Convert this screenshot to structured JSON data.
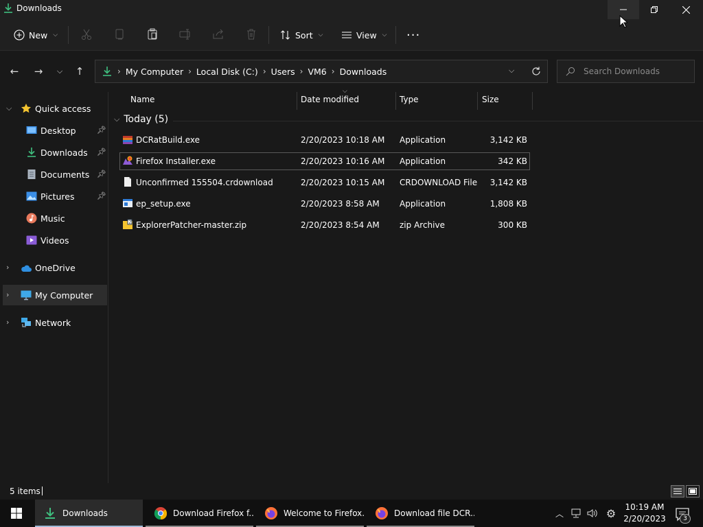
{
  "window": {
    "title": "Downloads"
  },
  "commandbar": {
    "new_label": "New",
    "sort_label": "Sort",
    "view_label": "View",
    "more_label": "···"
  },
  "address": {
    "crumbs": [
      "My Computer",
      "Local Disk (C:)",
      "Users",
      "VM6",
      "Downloads"
    ],
    "search_placeholder": "Search Downloads"
  },
  "sidebar": {
    "items": [
      {
        "label": "Quick access",
        "icon": "star-icon"
      },
      {
        "label": "Desktop",
        "icon": "desktop-icon"
      },
      {
        "label": "Downloads",
        "icon": "download-icon"
      },
      {
        "label": "Documents",
        "icon": "document-icon"
      },
      {
        "label": "Pictures",
        "icon": "pictures-icon"
      },
      {
        "label": "Music",
        "icon": "music-icon"
      },
      {
        "label": "Videos",
        "icon": "videos-icon"
      },
      {
        "label": "OneDrive",
        "icon": "cloud-icon"
      },
      {
        "label": "My Computer",
        "icon": "computer-icon"
      },
      {
        "label": "Network",
        "icon": "network-icon"
      }
    ]
  },
  "filelist": {
    "columns": {
      "name": "Name",
      "date": "Date modified",
      "type": "Type",
      "size": "Size"
    },
    "group": "Today (5)",
    "rows": [
      {
        "name": "DCRatBuild.exe",
        "date": "2/20/2023 10:18 AM",
        "type": "Application",
        "size": "3,142 KB",
        "icon": "installer-icon"
      },
      {
        "name": "Firefox Installer.exe",
        "date": "2/20/2023 10:16 AM",
        "type": "Application",
        "size": "342 KB",
        "icon": "firefox-installer-icon"
      },
      {
        "name": "Unconfirmed 155504.crdownload",
        "date": "2/20/2023 10:15 AM",
        "type": "CRDOWNLOAD File",
        "size": "3,142 KB",
        "icon": "blank-file-icon"
      },
      {
        "name": "ep_setup.exe",
        "date": "2/20/2023 8:58 AM",
        "type": "Application",
        "size": "1,808 KB",
        "icon": "app-window-icon"
      },
      {
        "name": "ExplorerPatcher-master.zip",
        "date": "2/20/2023 8:54 AM",
        "type": "zip Archive",
        "size": "300 KB",
        "icon": "zip-icon"
      }
    ]
  },
  "status": {
    "items": "5 items"
  },
  "taskbar": {
    "tasks": [
      {
        "label": "Downloads",
        "icon": "folder-download-icon"
      },
      {
        "label": "Download Firefox f...",
        "icon": "chrome-icon"
      },
      {
        "label": "Welcome to Firefox...",
        "icon": "firefox-icon"
      },
      {
        "label": "Download file DCR...",
        "icon": "firefox-icon"
      }
    ],
    "time": "10:19 AM",
    "date": "2/20/2023",
    "notification_count": "3"
  },
  "colors": {
    "accent_green": "#3fbf7f",
    "folder_yellow": "#f4c430",
    "selection_border": "#5a5a5a"
  }
}
